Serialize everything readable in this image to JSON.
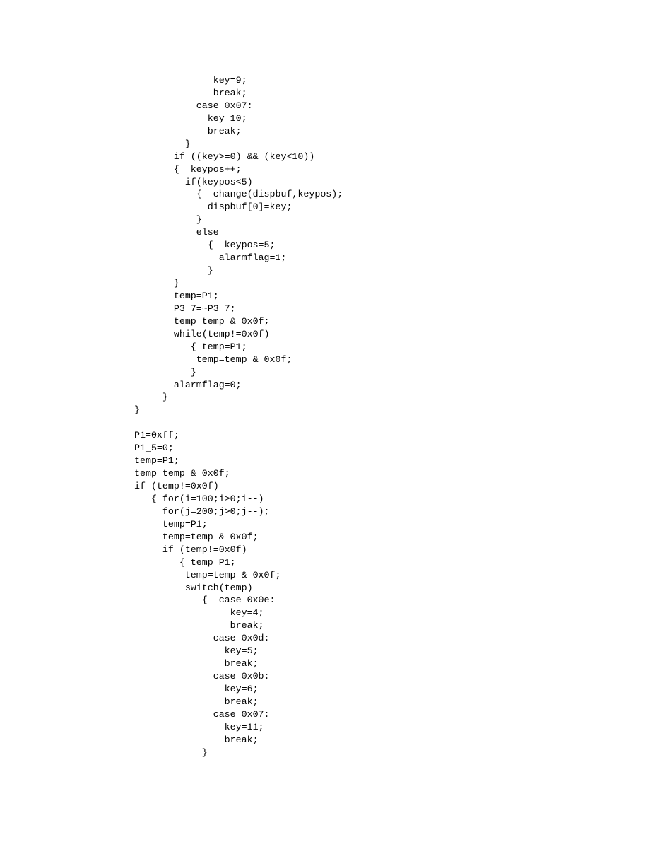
{
  "code": {
    "lines": [
      "              key=9;",
      "              break;",
      "           case 0x07:",
      "             key=10;",
      "             break;",
      "         }",
      "       if ((key>=0) && (key<10))",
      "       {  keypos++;",
      "         if(keypos<5)",
      "           {  change(dispbuf,keypos);",
      "             dispbuf[0]=key;",
      "           }",
      "           else",
      "             {  keypos=5;",
      "               alarmflag=1;",
      "             }",
      "       }",
      "       temp=P1;",
      "       P3_7=~P3_7;",
      "       temp=temp & 0x0f;",
      "       while(temp!=0x0f)",
      "          { temp=P1;",
      "           temp=temp & 0x0f;",
      "          }",
      "       alarmflag=0;",
      "     }",
      "}",
      "",
      "P1=0xff;",
      "P1_5=0;",
      "temp=P1;",
      "temp=temp & 0x0f;",
      "if (temp!=0x0f)",
      "   { for(i=100;i>0;i--)",
      "     for(j=200;j>0;j--);",
      "     temp=P1;",
      "     temp=temp & 0x0f;",
      "     if (temp!=0x0f)",
      "        { temp=P1;",
      "         temp=temp & 0x0f;",
      "         switch(temp)",
      "            {  case 0x0e:",
      "                 key=4;",
      "                 break;",
      "              case 0x0d:",
      "                key=5;",
      "                break;",
      "              case 0x0b:",
      "                key=6;",
      "                break;",
      "              case 0x07:",
      "                key=11;",
      "                break;",
      "            }"
    ]
  }
}
